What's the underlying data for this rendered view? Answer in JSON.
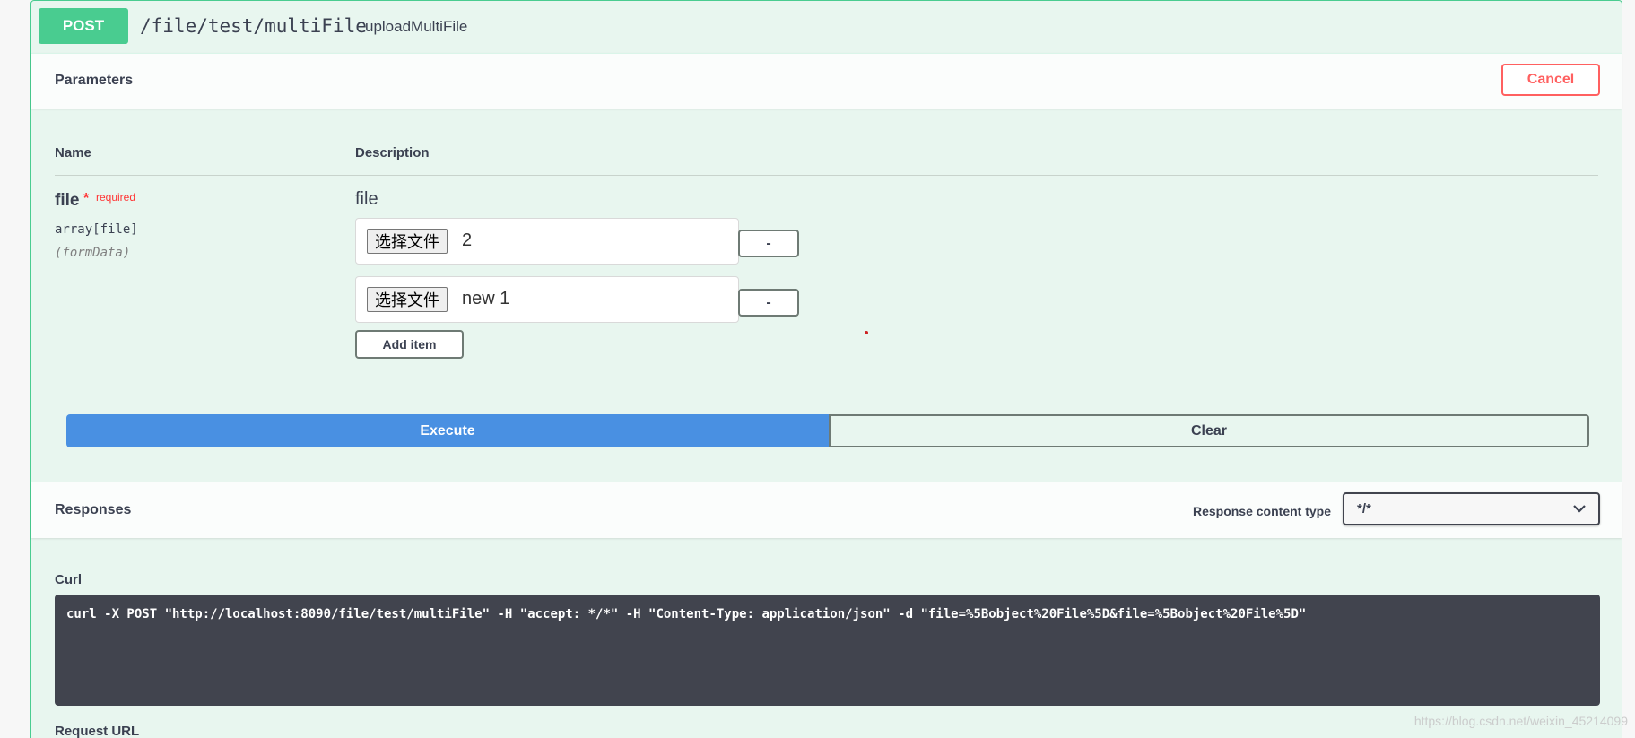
{
  "operation": {
    "method": "POST",
    "path": "/file/test/multiFile",
    "operation_id": "uploadMultiFile"
  },
  "parameters": {
    "title": "Parameters",
    "cancel_label": "Cancel",
    "columns": {
      "name": "Name",
      "description": "Description"
    },
    "param": {
      "name": "file",
      "required_star": "*",
      "required_text": "required",
      "type": "array[file]",
      "in": "(formData)",
      "description": "file",
      "items": [
        {
          "button_label": "选择文件",
          "file_name": "2",
          "remove_label": "-"
        },
        {
          "button_label": "选择文件",
          "file_name": "new 1",
          "remove_label": "-"
        }
      ],
      "add_item_label": "Add item"
    }
  },
  "actions": {
    "execute_label": "Execute",
    "clear_label": "Clear"
  },
  "responses": {
    "title": "Responses",
    "content_type_label": "Response content type",
    "content_type_value": "*/*"
  },
  "curl": {
    "label": "Curl",
    "command": "curl -X POST \"http://localhost:8090/file/test/multiFile\" -H \"accept: */*\" -H \"Content-Type: application/json\" -d \"file=%5Bobject%20File%5D&file=%5Bobject%20File%5D\""
  },
  "request_url": {
    "label": "Request URL"
  },
  "watermark": "https://blog.csdn.net/weixin_45214099",
  "colors": {
    "post_green": "#49cc90",
    "execute_blue": "#4990e2",
    "cancel_red": "#ff6060",
    "curl_bg": "#41444e"
  }
}
